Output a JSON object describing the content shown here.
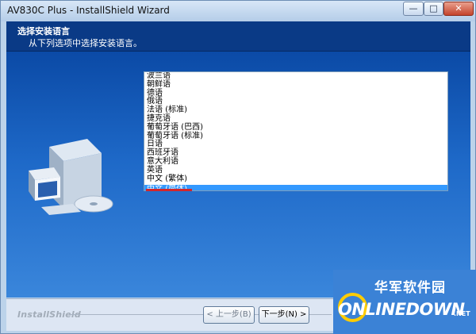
{
  "window": {
    "title": "AV830C Plus - InstallShield Wizard",
    "controls": {
      "min": "—",
      "max": "□",
      "close": "✕"
    }
  },
  "header": {
    "title": "选择安装语言",
    "subtitle": "从下列选项中选择安装语言。"
  },
  "languages": [
    "波兰语",
    "朝鲜语",
    "德语",
    "俄语",
    "法语 (标准)",
    "捷克语",
    "葡萄牙语 (巴西)",
    "葡萄牙语 (标准)",
    "日语",
    "西班牙语",
    "意大利语",
    "英语",
    "中文 (繁体)",
    "中文 (简体)"
  ],
  "selected_language": "中文 (简体)",
  "footer": {
    "brand": "InstallShield",
    "back_label": "< 上一步(B)",
    "next_label": "下一步(N) >"
  },
  "watermark": {
    "title": "华军软件园",
    "logo": "ONLINEDOWN",
    "suffix": ".NET"
  },
  "colors": {
    "header_bg": "#0a3a86",
    "selection": "#3399ff",
    "underline": "#d4262b",
    "watermark_bg": "#3b82d6"
  }
}
